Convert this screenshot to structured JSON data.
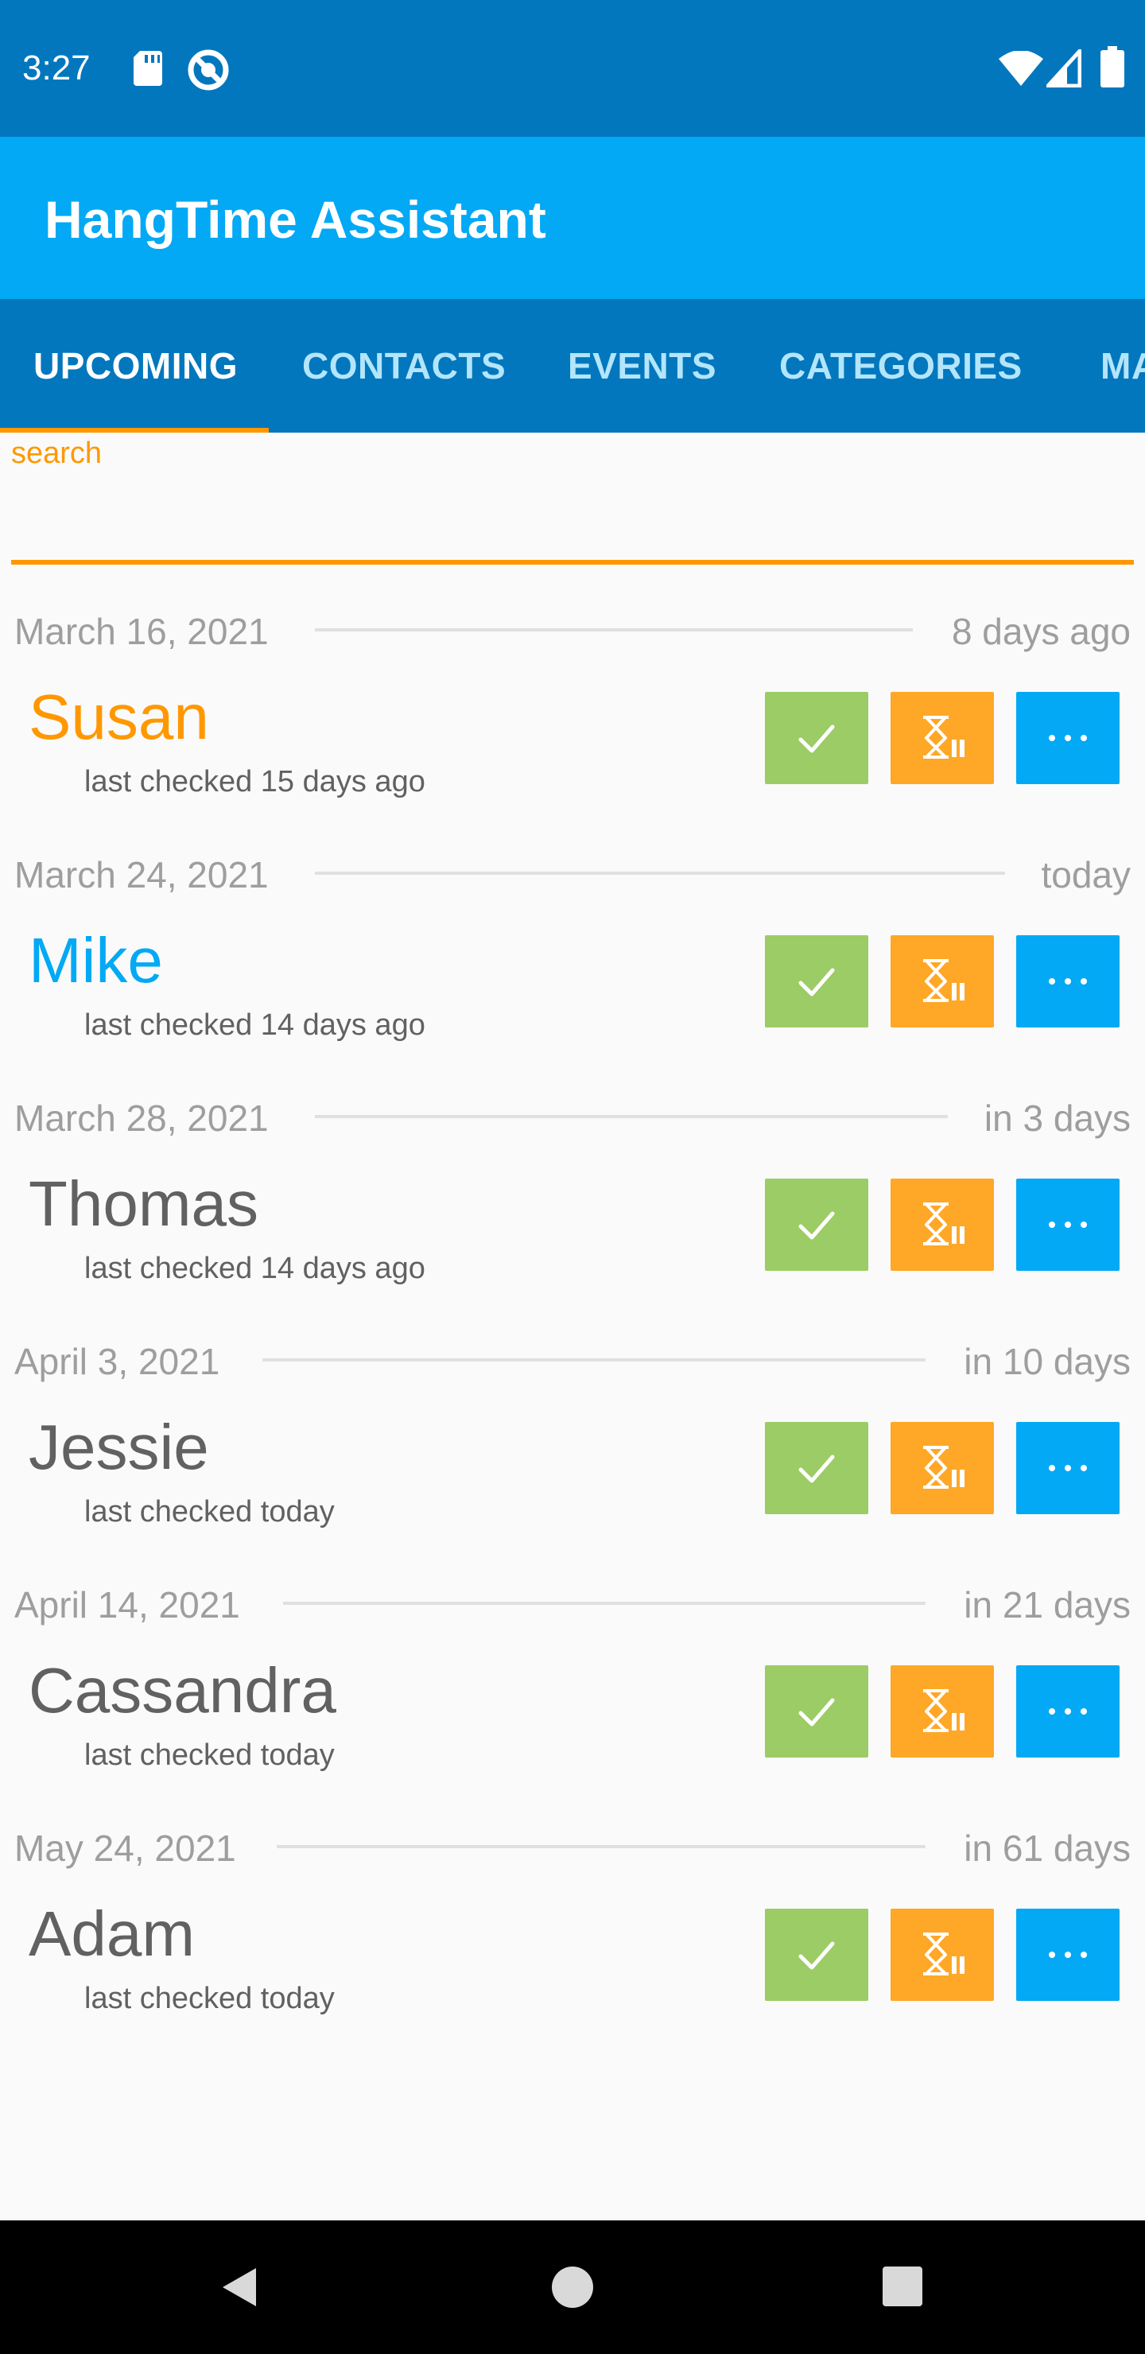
{
  "status_bar": {
    "time": "3:27",
    "icons": [
      "sd-card-icon",
      "sync-icon",
      "wifi-icon",
      "signal-icon",
      "battery-icon"
    ]
  },
  "app_bar": {
    "title": "HangTime Assistant"
  },
  "tabs": [
    {
      "label": "UPCOMING",
      "active": true
    },
    {
      "label": "CONTACTS",
      "active": false
    },
    {
      "label": "EVENTS",
      "active": false
    },
    {
      "label": "CATEGORIES",
      "active": false
    },
    {
      "label": "MA",
      "active": false
    }
  ],
  "search": {
    "label": "search",
    "value": "",
    "placeholder": ""
  },
  "upcoming": [
    {
      "date": "March 16, 2021",
      "relative": "8 days ago",
      "name": "Susan",
      "name_color": "#ff9800",
      "last_checked": "last checked 15 days ago"
    },
    {
      "date": "March 24, 2021",
      "relative": "today",
      "name": "Mike",
      "name_color": "#03a9f4",
      "last_checked": "last checked 14 days ago"
    },
    {
      "date": "March 28, 2021",
      "relative": "in 3 days",
      "name": "Thomas",
      "name_color": "#616161",
      "last_checked": "last checked 14 days ago"
    },
    {
      "date": "April 3, 2021",
      "relative": "in 10 days",
      "name": "Jessie",
      "name_color": "#616161",
      "last_checked": "last checked today"
    },
    {
      "date": "April 14, 2021",
      "relative": "in 21 days",
      "name": "Cassandra",
      "name_color": "#616161",
      "last_checked": "last checked today"
    },
    {
      "date": "May 24, 2021",
      "relative": "in 61 days",
      "name": "Adam",
      "name_color": "#616161",
      "last_checked": "last checked today"
    }
  ],
  "colors": {
    "status_bar": "#0277bd",
    "app_bar": "#03a9f4",
    "tab_bar": "#0277bd",
    "accent": "#ff9800",
    "check_button": "#9ccc65",
    "snooze_button": "#ffa726",
    "more_button": "#03a9f4"
  }
}
